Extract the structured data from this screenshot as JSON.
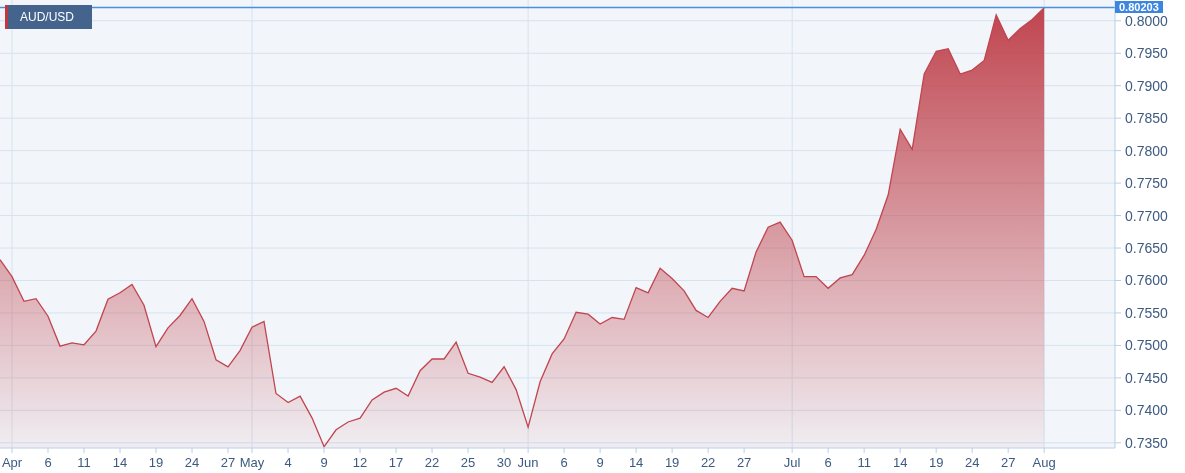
{
  "legend": {
    "color": "#c0393f"
  },
  "price_label": "0.80203",
  "chart_data": {
    "type": "area",
    "ylim": [
      0.7342,
      0.8032
    ],
    "grid": true,
    "ref_lines": [
      {
        "axis": "y",
        "value": 0.80203,
        "color": "#4a8fe0"
      }
    ],
    "categories": [
      null,
      "Apr",
      null,
      null,
      "6",
      null,
      null,
      "11",
      null,
      null,
      "14",
      null,
      null,
      "19",
      null,
      null,
      "24",
      null,
      null,
      "27",
      null,
      "May",
      null,
      null,
      "4",
      null,
      null,
      "9",
      null,
      null,
      "12",
      null,
      null,
      "17",
      null,
      null,
      "22",
      null,
      null,
      "25",
      null,
      null,
      "30",
      null,
      "Jun",
      null,
      null,
      "6",
      null,
      null,
      "9",
      null,
      null,
      "14",
      null,
      null,
      "19",
      null,
      null,
      "22",
      null,
      null,
      "27",
      null,
      null,
      null,
      "Jul",
      null,
      null,
      "6",
      null,
      null,
      "11",
      null,
      null,
      "14",
      null,
      null,
      "19",
      null,
      null,
      "24",
      null,
      null,
      "27",
      null,
      null,
      "Aug"
    ],
    "series": [
      {
        "name": "AUD/USD",
        "color": "#c0454f",
        "values": [
          0.7632,
          0.7606,
          0.7568,
          0.7572,
          0.7545,
          0.7499,
          0.7504,
          0.7501,
          0.7522,
          0.7571,
          0.7581,
          0.7594,
          0.7562,
          0.7498,
          0.7527,
          0.7546,
          0.7572,
          0.7537,
          0.7478,
          0.7467,
          0.7492,
          0.7528,
          0.7537,
          0.7426,
          0.7412,
          0.7422,
          0.7388,
          0.7344,
          0.737,
          0.7382,
          0.7388,
          0.7416,
          0.7428,
          0.7434,
          0.7422,
          0.7461,
          0.7479,
          0.7479,
          0.7505,
          0.7457,
          0.7451,
          0.7443,
          0.7467,
          0.7432,
          0.7374,
          0.7444,
          0.7487,
          0.751,
          0.7551,
          0.7548,
          0.7533,
          0.7543,
          0.754,
          0.7589,
          0.7581,
          0.7619,
          0.7603,
          0.7584,
          0.7554,
          0.7543,
          0.7568,
          0.7588,
          0.7584,
          0.7644,
          0.7682,
          0.769,
          0.7662,
          0.7606,
          0.7606,
          0.7588,
          0.7604,
          0.7609,
          0.7639,
          0.7679,
          0.7732,
          0.7833,
          0.7802,
          0.7918,
          0.7953,
          0.7957,
          0.7918,
          0.7924,
          0.7939,
          0.8009,
          0.797,
          0.7988,
          0.8002,
          0.802
        ]
      }
    ],
    "yticks": [
      {
        "value": 0.735,
        "label": "0.7350"
      },
      {
        "value": 0.74,
        "label": "0.7400"
      },
      {
        "value": 0.745,
        "label": "0.7450"
      },
      {
        "value": 0.75,
        "label": "0.7500"
      },
      {
        "value": 0.755,
        "label": "0.7550"
      },
      {
        "value": 0.76,
        "label": "0.7600"
      },
      {
        "value": 0.765,
        "label": "0.7650"
      },
      {
        "value": 0.77,
        "label": "0.7700"
      },
      {
        "value": 0.775,
        "label": "0.7750"
      },
      {
        "value": 0.78,
        "label": "0.7800"
      },
      {
        "value": 0.785,
        "label": "0.7850"
      },
      {
        "value": 0.79,
        "label": "0.7900"
      },
      {
        "value": 0.795,
        "label": "0.7950"
      },
      {
        "value": 0.8,
        "label": "0.8000"
      }
    ]
  }
}
